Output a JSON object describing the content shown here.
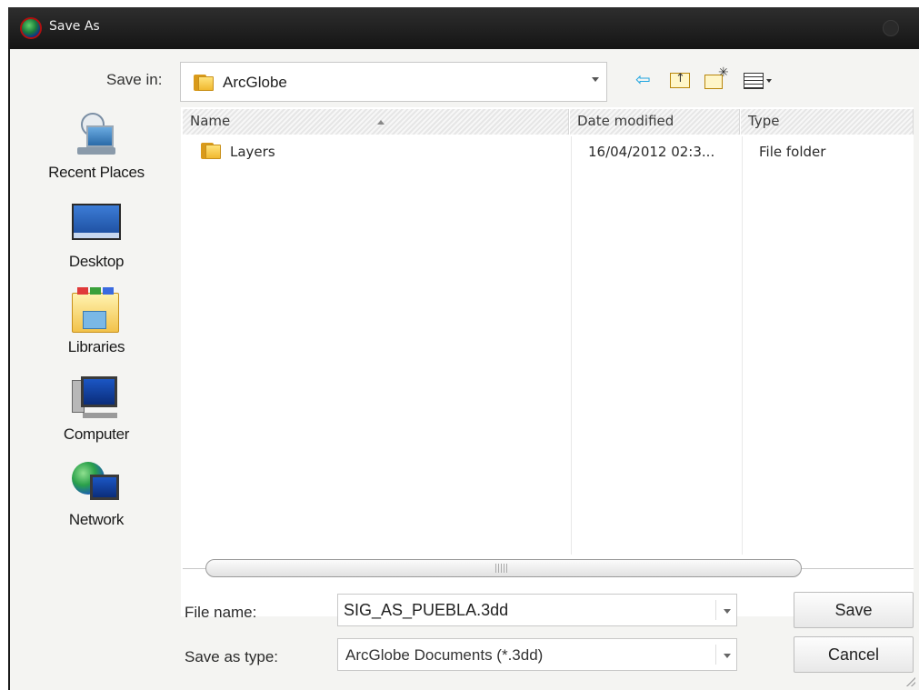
{
  "window": {
    "title": "Save As",
    "app_icon": "arcglobe-globe-icon"
  },
  "toolbar": {
    "save_in_label": "Save in:",
    "save_in_value": "ArcGlobe",
    "icons": [
      "back-arrow-icon",
      "up-one-level-icon",
      "new-folder-icon",
      "view-menu-icon"
    ]
  },
  "places": [
    {
      "label": "Recent Places",
      "icon": "recent-places-icon"
    },
    {
      "label": "Desktop",
      "icon": "desktop-icon"
    },
    {
      "label": "Libraries",
      "icon": "libraries-icon"
    },
    {
      "label": "Computer",
      "icon": "computer-icon"
    },
    {
      "label": "Network",
      "icon": "network-icon"
    }
  ],
  "file_list": {
    "columns": [
      "Name",
      "Date modified",
      "Type"
    ],
    "sort_column": "Name",
    "rows": [
      {
        "name": "Layers",
        "date_modified": "16/04/2012 02:3...",
        "type": "File folder",
        "icon": "folder-icon"
      }
    ]
  },
  "form": {
    "file_name_label": "File name:",
    "file_name_value": "SIG_AS_PUEBLA.3dd",
    "save_as_type_label": "Save as type:",
    "save_as_type_value": "ArcGlobe Documents (*.3dd)"
  },
  "buttons": {
    "save": "Save",
    "cancel": "Cancel"
  }
}
